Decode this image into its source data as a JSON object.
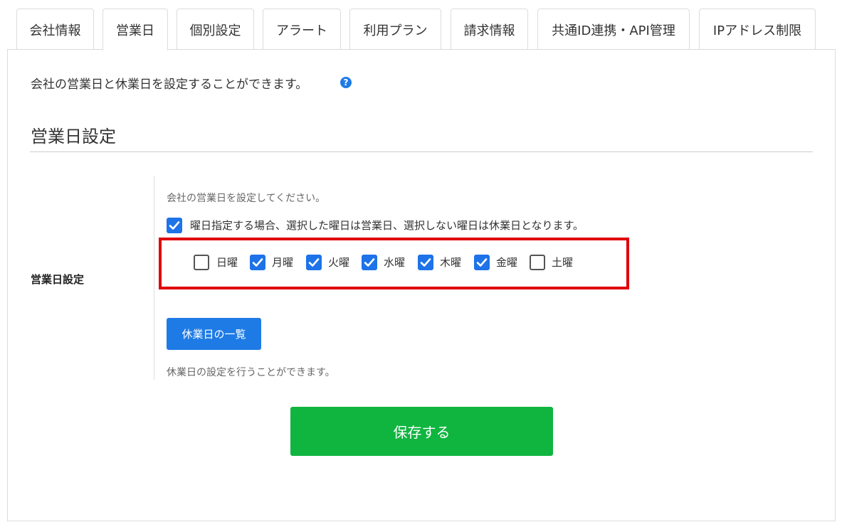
{
  "tabs": [
    {
      "label": "会社情報",
      "active": false
    },
    {
      "label": "営業日",
      "active": true
    },
    {
      "label": "個別設定",
      "active": false
    },
    {
      "label": "アラート",
      "active": false
    },
    {
      "label": "利用プラン",
      "active": false
    },
    {
      "label": "請求情報",
      "active": false
    },
    {
      "label": "共通ID連携・API管理",
      "active": false
    },
    {
      "label": "IPアドレス制限",
      "active": false
    }
  ],
  "page": {
    "description": "会社の営業日と休業日を設定することができます。",
    "help_icon": "?",
    "section_title": "営業日設定"
  },
  "business_days": {
    "row_label": "営業日設定",
    "hint": "会社の営業日を設定してください。",
    "weekday_mode": {
      "checked": true,
      "label": "曜日指定する場合、選択した曜日は営業日、選択しない曜日は休業日となります。"
    },
    "days": [
      {
        "label": "日曜",
        "checked": false
      },
      {
        "label": "月曜",
        "checked": true
      },
      {
        "label": "火曜",
        "checked": true
      },
      {
        "label": "水曜",
        "checked": true
      },
      {
        "label": "木曜",
        "checked": true
      },
      {
        "label": "金曜",
        "checked": true
      },
      {
        "label": "土曜",
        "checked": false
      }
    ],
    "holiday_button_label": "休業日の一覧",
    "holiday_hint": "休業日の設定を行うことができます。"
  },
  "save_label": "保存する",
  "colors": {
    "accent_blue": "#1e7be6",
    "save_green": "#10b540",
    "highlight_red": "#e0000b"
  }
}
